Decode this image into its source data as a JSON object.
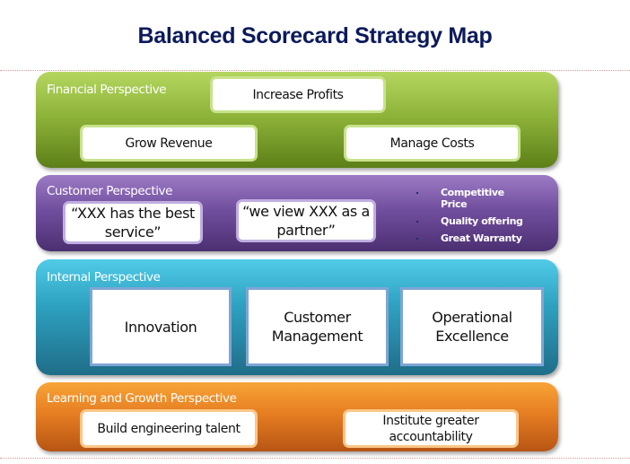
{
  "title": "Balanced Scorecard Strategy Map",
  "colors": {
    "title": "#0c1a5b",
    "financial": "#8fb43a",
    "customer": "#714f9f",
    "internal": "#2ea1c0",
    "learning": "#e67e22"
  },
  "perspectives": {
    "financial": {
      "label": "Financial Perspective",
      "objectives": [
        "Increase Profits",
        "Grow Revenue",
        "Manage Costs"
      ]
    },
    "customer": {
      "label": "Customer Perspective",
      "objectives": [
        "“XXX has the best service”",
        "“we view XXX as a partner”"
      ],
      "bullets": [
        "Competitive Price",
        "Quality offering",
        "Great Warranty"
      ]
    },
    "internal": {
      "label": "Internal Perspective",
      "objectives": [
        "Innovation",
        "Customer Management",
        "Operational Excellence"
      ]
    },
    "learning": {
      "label": "Learning and Growth Perspective",
      "objectives": [
        "Build engineering talent",
        "Institute greater accountability"
      ]
    }
  }
}
